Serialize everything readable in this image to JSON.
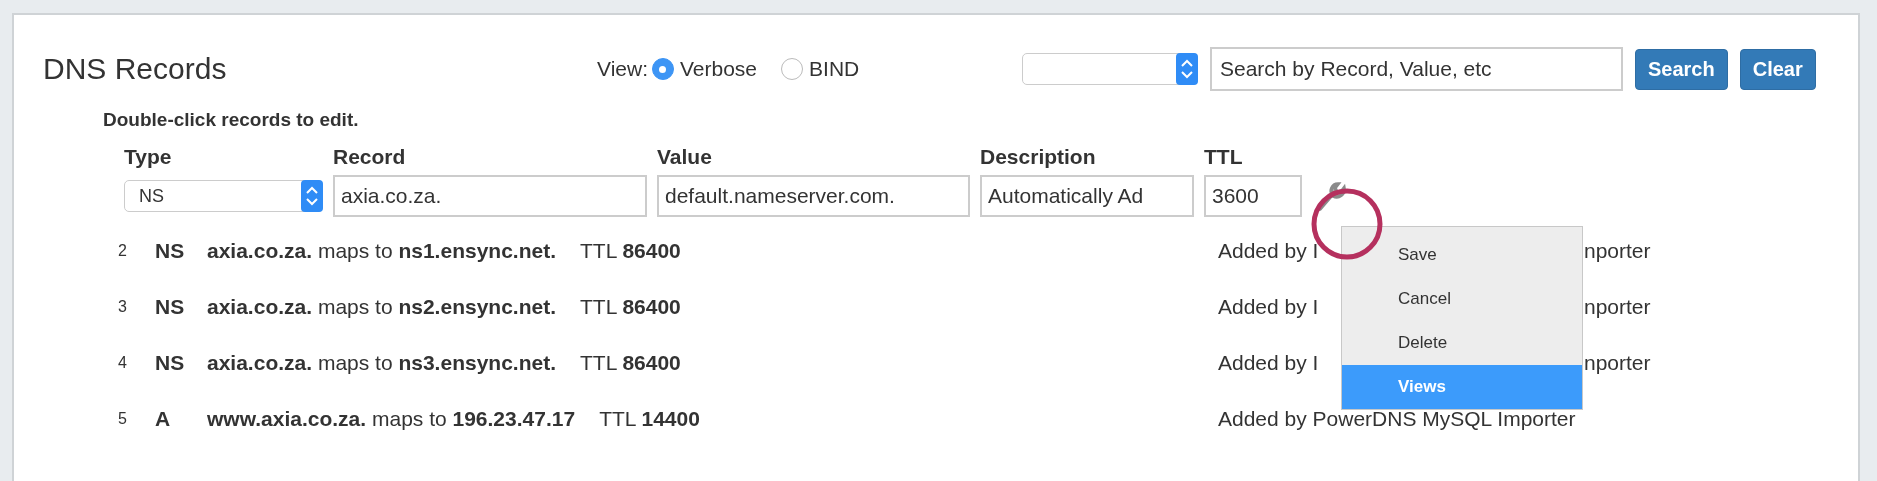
{
  "title": "DNS Records",
  "view": {
    "label": "View:",
    "options": [
      {
        "label": "Verbose",
        "selected": true
      },
      {
        "label": "BIND",
        "selected": false
      }
    ]
  },
  "search": {
    "placeholder": "Search by Record, Value, etc"
  },
  "buttons": [
    "Search",
    "Clear"
  ],
  "hint": "Double-click records to edit.",
  "editor": {
    "columns": [
      "Type",
      "Record",
      "Value",
      "Description",
      "TTL"
    ],
    "type": "NS",
    "record": "axia.co.za.",
    "value": "default.nameserver.com.",
    "description": "Automatically Ad",
    "ttl": "3600"
  },
  "menu": [
    {
      "label": "Save",
      "selected": false
    },
    {
      "label": "Cancel",
      "selected": false
    },
    {
      "label": "Delete",
      "selected": false
    },
    {
      "label": "Views",
      "selected": true
    }
  ],
  "records": [
    {
      "number": "2",
      "type": "NS",
      "mapping": "**axia.co.za.** maps to **ns1.ensync.net.**",
      "ttl": "TTL **86400**",
      "description_parts": [
        "Added by I",
        "nporter"
      ]
    },
    {
      "number": "3",
      "type": "NS",
      "mapping": "**axia.co.za.** maps to **ns2.ensync.net.**",
      "ttl": "TTL **86400**",
      "description_parts": [
        "Added by I",
        "nporter"
      ]
    },
    {
      "number": "4",
      "type": "NS",
      "mapping": "**axia.co.za.** maps to **ns3.ensync.net.**",
      "ttl": "TTL **86400**",
      "description_parts": [
        "Added by I",
        "nporter"
      ]
    },
    {
      "number": "5",
      "type": "A",
      "mapping": "**www.axia.co.za.** maps to **196.23.47.17**",
      "ttl": "TTL **14400**",
      "description_parts": [
        "Added by PowerDNS MySQL Importer"
      ]
    }
  ]
}
